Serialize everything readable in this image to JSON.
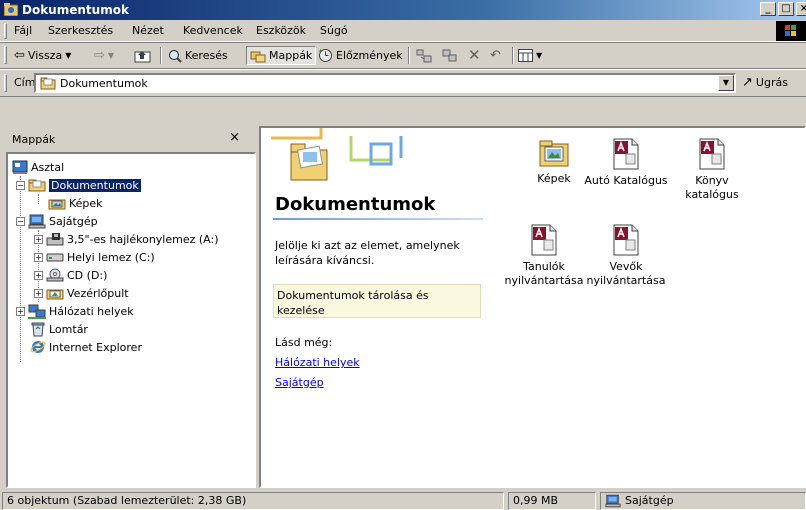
{
  "window": {
    "title": "Dokumentumok"
  },
  "menu": [
    "Fájl",
    "Szerkesztés",
    "Nézet",
    "Kedvencek",
    "Eszközök",
    "Súgó"
  ],
  "toolbar": {
    "back": "Vissza",
    "search": "Keresés",
    "folders": "Mappák",
    "history": "Előzmények"
  },
  "address": {
    "label": "Cím",
    "value": "Dokumentumok",
    "go": "Ugrás"
  },
  "left_pane": {
    "title": "Mappák",
    "close": "×",
    "tree": [
      "Asztal",
      "Dokumentumok",
      "Képek",
      "Sajátgép",
      "3,5\"-es hajlékonylemez (A:)",
      "Helyi lemez (C:)",
      "CD (D:)",
      "Vezérlőpult",
      "Hálózati helyek",
      "Lomtár",
      "Internet Explorer"
    ]
  },
  "right_pane": {
    "heading": "Dokumentumok",
    "description": "Jelölje ki azt az elemet, amelynek leírására kíváncsi.",
    "info_box": "Dokumentumok tárolása és kezelése",
    "see_also": "Lásd még:",
    "links": [
      "Hálózati helyek",
      "Sajátgép"
    ],
    "items": [
      {
        "label": "Képek",
        "icon": "folder-pictures-icon"
      },
      {
        "label": "Autó Katalógus",
        "icon": "access-db-icon"
      },
      {
        "label": "Könyv katalógus",
        "icon": "access-db-icon"
      },
      {
        "label": "Tanulók nyilvántartása",
        "icon": "access-db-icon"
      },
      {
        "label": "Vevők nyilvántartása",
        "icon": "access-db-icon"
      }
    ]
  },
  "status": {
    "objects": "6 objektum  (Szabad lemezterület: 2,38 GB)",
    "size": "0,99 MB",
    "location": "Sajátgép"
  }
}
